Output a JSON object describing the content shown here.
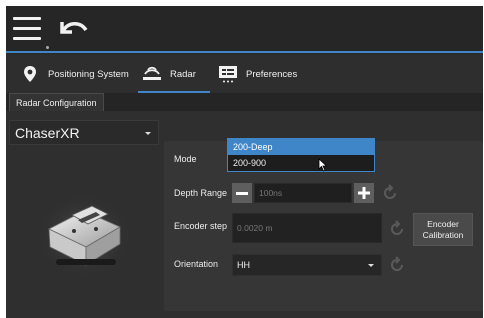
{
  "header": {
    "menu_icon": "hamburger-icon",
    "back_icon": "back-arrow-icon"
  },
  "tabs": [
    {
      "label": "Positioning System",
      "icon": "location-pin-icon"
    },
    {
      "label": "Radar",
      "icon": "radar-waves-icon",
      "active": true
    },
    {
      "label": "Preferences",
      "icon": "preferences-icon"
    }
  ],
  "subtab": {
    "label": "Radar Configuration"
  },
  "device": {
    "selected": "ChaserXR"
  },
  "form": {
    "mode_label": "Mode",
    "depth_range_label": "Depth Range",
    "depth_value": "100ns",
    "encoder_step_label": "Encoder step",
    "encoder_value": "0.0020 m",
    "encoder_calibration_label": "Encoder\nCalibration",
    "orientation_label": "Orientation",
    "orientation_value": "HH"
  },
  "mode_dropdown": {
    "options": [
      "200-Deep",
      "200-900"
    ],
    "selected": "200-Deep"
  },
  "colors": {
    "accent": "#3f86c8",
    "background": "#2b2b2b",
    "panel": "#363636"
  }
}
